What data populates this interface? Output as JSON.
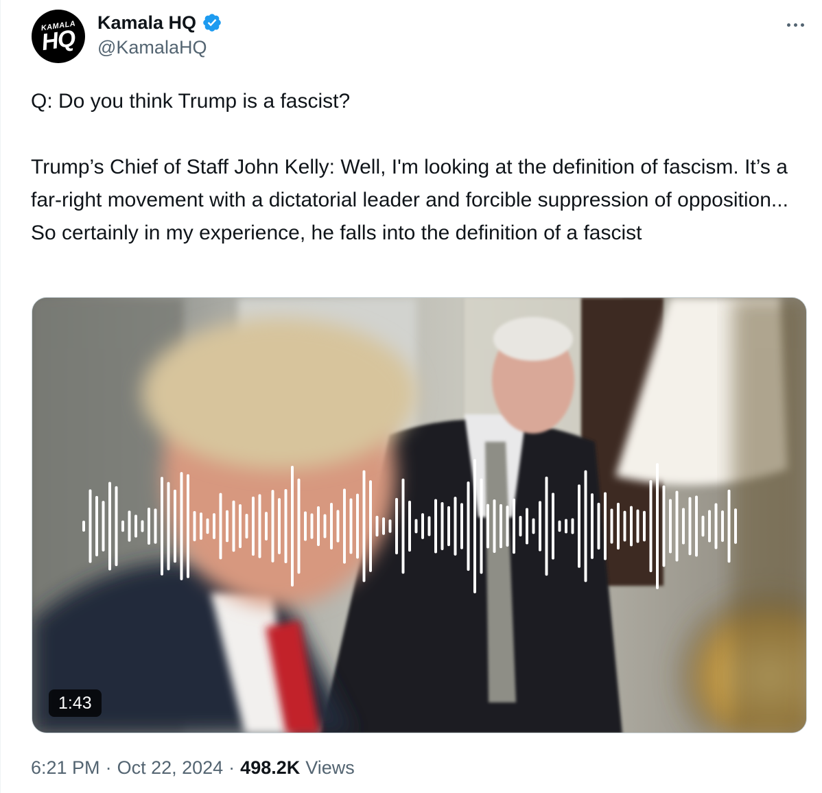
{
  "author": {
    "display_name": "Kamala HQ",
    "handle": "@KamalaHQ",
    "avatar_text_top": "KAMALA",
    "avatar_text_main": "HQ",
    "verified": true,
    "verified_color": "#1d9bf0"
  },
  "more_menu_icon": "more-horizontal-icon",
  "tweet": {
    "question": "Q: Do you think Trump is a fascist?",
    "answer": "Trump’s Chief of Staff John Kelly: Well, I'm looking at the definition of fascism. It’s a far-right movement with a dictatorial leader and forcible suppression of opposition... So certainly in my experience, he falls into the definition of a fascist"
  },
  "media": {
    "type": "video",
    "duration": "1:43"
  },
  "meta": {
    "time": "6:21 PM",
    "separator": "·",
    "date": "Oct 22, 2024",
    "views_count": "498.2K",
    "views_label": "Views"
  }
}
